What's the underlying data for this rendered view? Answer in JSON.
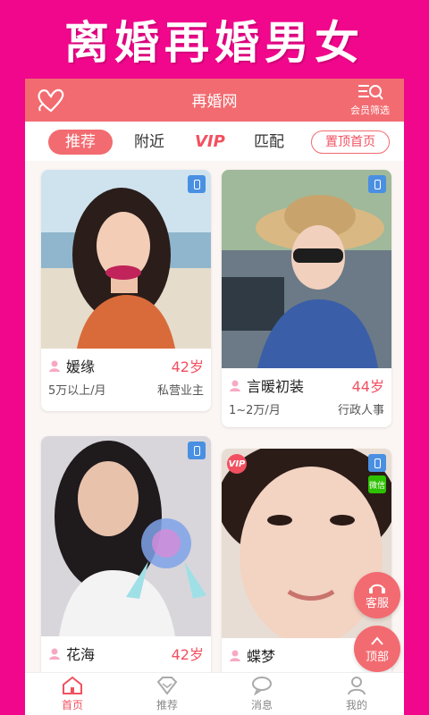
{
  "banner": {
    "title": "离婚再婚男女"
  },
  "header": {
    "title": "再婚网",
    "filter_label": "会员筛选"
  },
  "tabs": {
    "recommend": "推荐",
    "nearby": "附近",
    "vip": "VIP",
    "match": "匹配",
    "pin_top": "置顶首页"
  },
  "profiles": [
    {
      "name": "媛缘",
      "age": "42岁",
      "income": "5万以上/月",
      "job": "私营业主"
    },
    {
      "name": "言暖初装",
      "age": "44岁",
      "income": "1~2万/月",
      "job": "行政人事"
    },
    {
      "name": "花海",
      "age": "42岁"
    },
    {
      "name": "蝶梦",
      "vip_badge": "VIP",
      "wechat_badge": "微信"
    }
  ],
  "floating": {
    "service": "客服",
    "top": "顶部"
  },
  "bottom_nav": [
    {
      "label": "首页"
    },
    {
      "label": "推荐"
    },
    {
      "label": "消息"
    },
    {
      "label": "我的"
    }
  ],
  "colors": {
    "background": "#f0078c",
    "accent": "#f26b70",
    "price": "#f25060"
  }
}
